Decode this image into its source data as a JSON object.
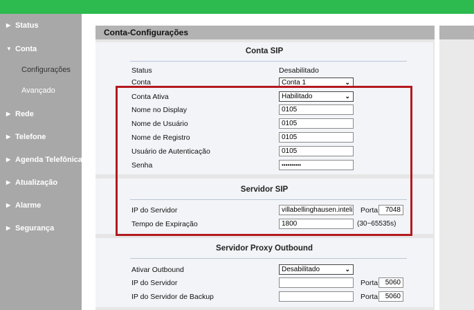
{
  "sidebar": {
    "status": "Status",
    "conta": "Conta",
    "configuracoes": "Configurações",
    "avancado": "Avançado",
    "rede": "Rede",
    "telefone": "Telefone",
    "agenda": "Agenda Telefônica",
    "atualizacao": "Atualização",
    "alarme": "Alarme",
    "seguranca": "Segurança"
  },
  "header": {
    "title": "Conta-Configurações"
  },
  "sip": {
    "title": "Conta SIP",
    "status_label": "Status",
    "status_value": "Desabilitado",
    "conta_label": "Conta",
    "conta_value": "Conta 1",
    "ativa_label": "Conta Ativa",
    "ativa_value": "Habilitado",
    "display_label": "Nome no Display",
    "display_value": "0105",
    "usuario_label": "Nome de Usuário",
    "usuario_value": "0105",
    "registro_label": "Nome de Registro",
    "registro_value": "0105",
    "auth_label": "Usuário de Autenticação",
    "auth_value": "0105",
    "senha_label": "Senha",
    "senha_value": "••••••••••"
  },
  "servidor": {
    "title": "Servidor SIP",
    "ip_label": "IP do Servidor",
    "ip_value": "villabellinghausen.inteli",
    "porta_label": "Porta",
    "porta_value": "7048",
    "expira_label": "Tempo de Expiração",
    "expira_value": "1800",
    "expira_range": "(30~65535s)"
  },
  "proxy": {
    "title": "Servidor Proxy Outbound",
    "ativar_label": "Ativar Outbound",
    "ativar_value": "Desabilitado",
    "ip_label": "IP do Servidor",
    "ip_value": "",
    "porta_label": "Porta",
    "porta_value": "5060",
    "backup_label": "IP do Servidor de Backup",
    "backup_value": "",
    "backup_porta_label": "Porta",
    "backup_porta_value": "5060"
  },
  "colors": {
    "topbar": "#2dba4e",
    "highlight": "#b3191f",
    "sidebar": "#a8a8a8"
  }
}
